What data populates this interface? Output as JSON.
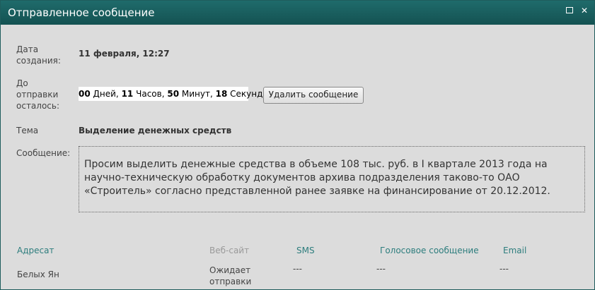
{
  "window": {
    "title": "Отправленное сообщение"
  },
  "details": {
    "created_label": "Дата создания:",
    "created_value": "11 февраля, 12:27",
    "remaining_label": "До отправки осталось:",
    "countdown": {
      "days": "00",
      "days_label": "Дней,",
      "hours": "11",
      "hours_label": "Часов,",
      "minutes": "50",
      "minutes_label": "Минут,",
      "seconds": "18",
      "seconds_label": "Секунд"
    },
    "delete_button": "Удалить сообщение",
    "subject_label": "Тема",
    "subject_value": "Выделение денежных средств",
    "message_label": "Сообщение:",
    "message_text": "Просим выделить денежные средства в объеме 108 тыс. руб. в I квартале 2013 года на научно-техническую обработку документов архива подразделения таково-то ОАО «Строитель» согласно представленной ранее заявке на финансирование от 20.12.2012."
  },
  "recipients": {
    "columns": [
      "Адресат",
      "Веб-сайт",
      "SMS",
      "Голосовое сообщение",
      "Email"
    ],
    "rows": [
      {
        "name": "Белых Ян",
        "website": "Ожидает отправки",
        "sms": "---",
        "voice": "---",
        "email": "---"
      }
    ]
  },
  "colors": {
    "titlebar": "#145252",
    "link": "#2d7d7d"
  }
}
